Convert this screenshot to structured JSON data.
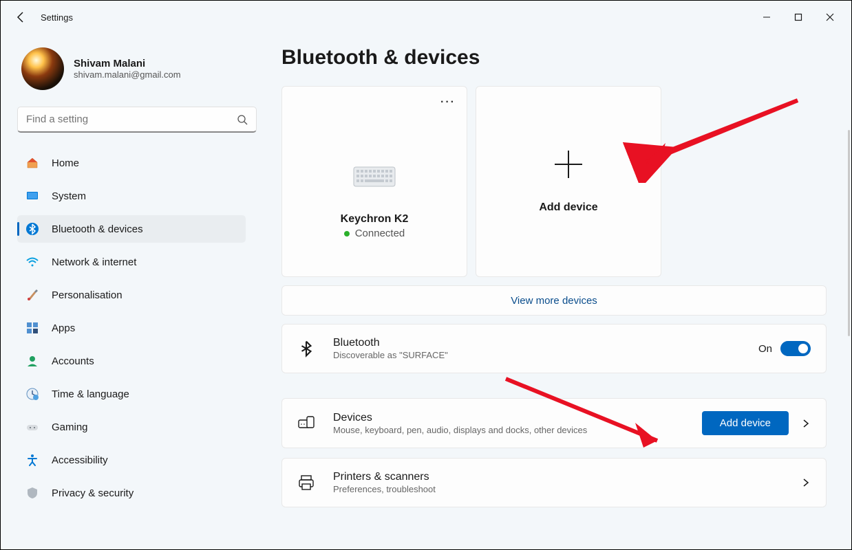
{
  "window": {
    "title": "Settings"
  },
  "user": {
    "name": "Shivam Malani",
    "email": "shivam.malani@gmail.com"
  },
  "search": {
    "placeholder": "Find a setting"
  },
  "nav": {
    "items": [
      {
        "label": "Home"
      },
      {
        "label": "System"
      },
      {
        "label": "Bluetooth & devices"
      },
      {
        "label": "Network & internet"
      },
      {
        "label": "Personalisation"
      },
      {
        "label": "Apps"
      },
      {
        "label": "Accounts"
      },
      {
        "label": "Time & language"
      },
      {
        "label": "Gaming"
      },
      {
        "label": "Accessibility"
      },
      {
        "label": "Privacy & security"
      }
    ]
  },
  "page": {
    "title": "Bluetooth & devices"
  },
  "devices": {
    "tile1": {
      "name": "Keychron K2",
      "status": "Connected"
    },
    "add_tile": {
      "label": "Add device"
    }
  },
  "view_more": "View more devices",
  "bluetooth": {
    "title": "Bluetooth",
    "sub": "Discoverable as \"SURFACE\"",
    "state": "On"
  },
  "devices_row": {
    "title": "Devices",
    "sub": "Mouse, keyboard, pen, audio, displays and docks, other devices",
    "button": "Add device"
  },
  "printers_row": {
    "title": "Printers & scanners",
    "sub": "Preferences, troubleshoot"
  }
}
